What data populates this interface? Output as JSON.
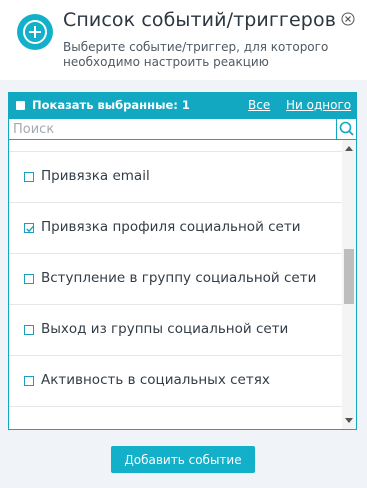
{
  "header": {
    "title": "Список событий/триггеров",
    "subtitle": "Выберите событие/триггер, для которого необходимо настроить реакцию",
    "icon": "plus-circle-icon",
    "accent_color": "#12b0c9"
  },
  "toolbar": {
    "show_selected_label": "Показать выбранные: 1",
    "all_label": "Все",
    "none_label": "Ни одного"
  },
  "search": {
    "placeholder": "Поиск",
    "value": ""
  },
  "list": {
    "items": [
      {
        "label": "Привязка email",
        "checked": false
      },
      {
        "label": "Привязка профиля социальной сети",
        "checked": true
      },
      {
        "label": "Вступление в группу социальной сети",
        "checked": false
      },
      {
        "label": "Выход из группы социальной сети",
        "checked": false
      },
      {
        "label": "Активность в социальных сетях",
        "checked": false
      }
    ]
  },
  "footer": {
    "add_button_label": "Добавить событие"
  }
}
